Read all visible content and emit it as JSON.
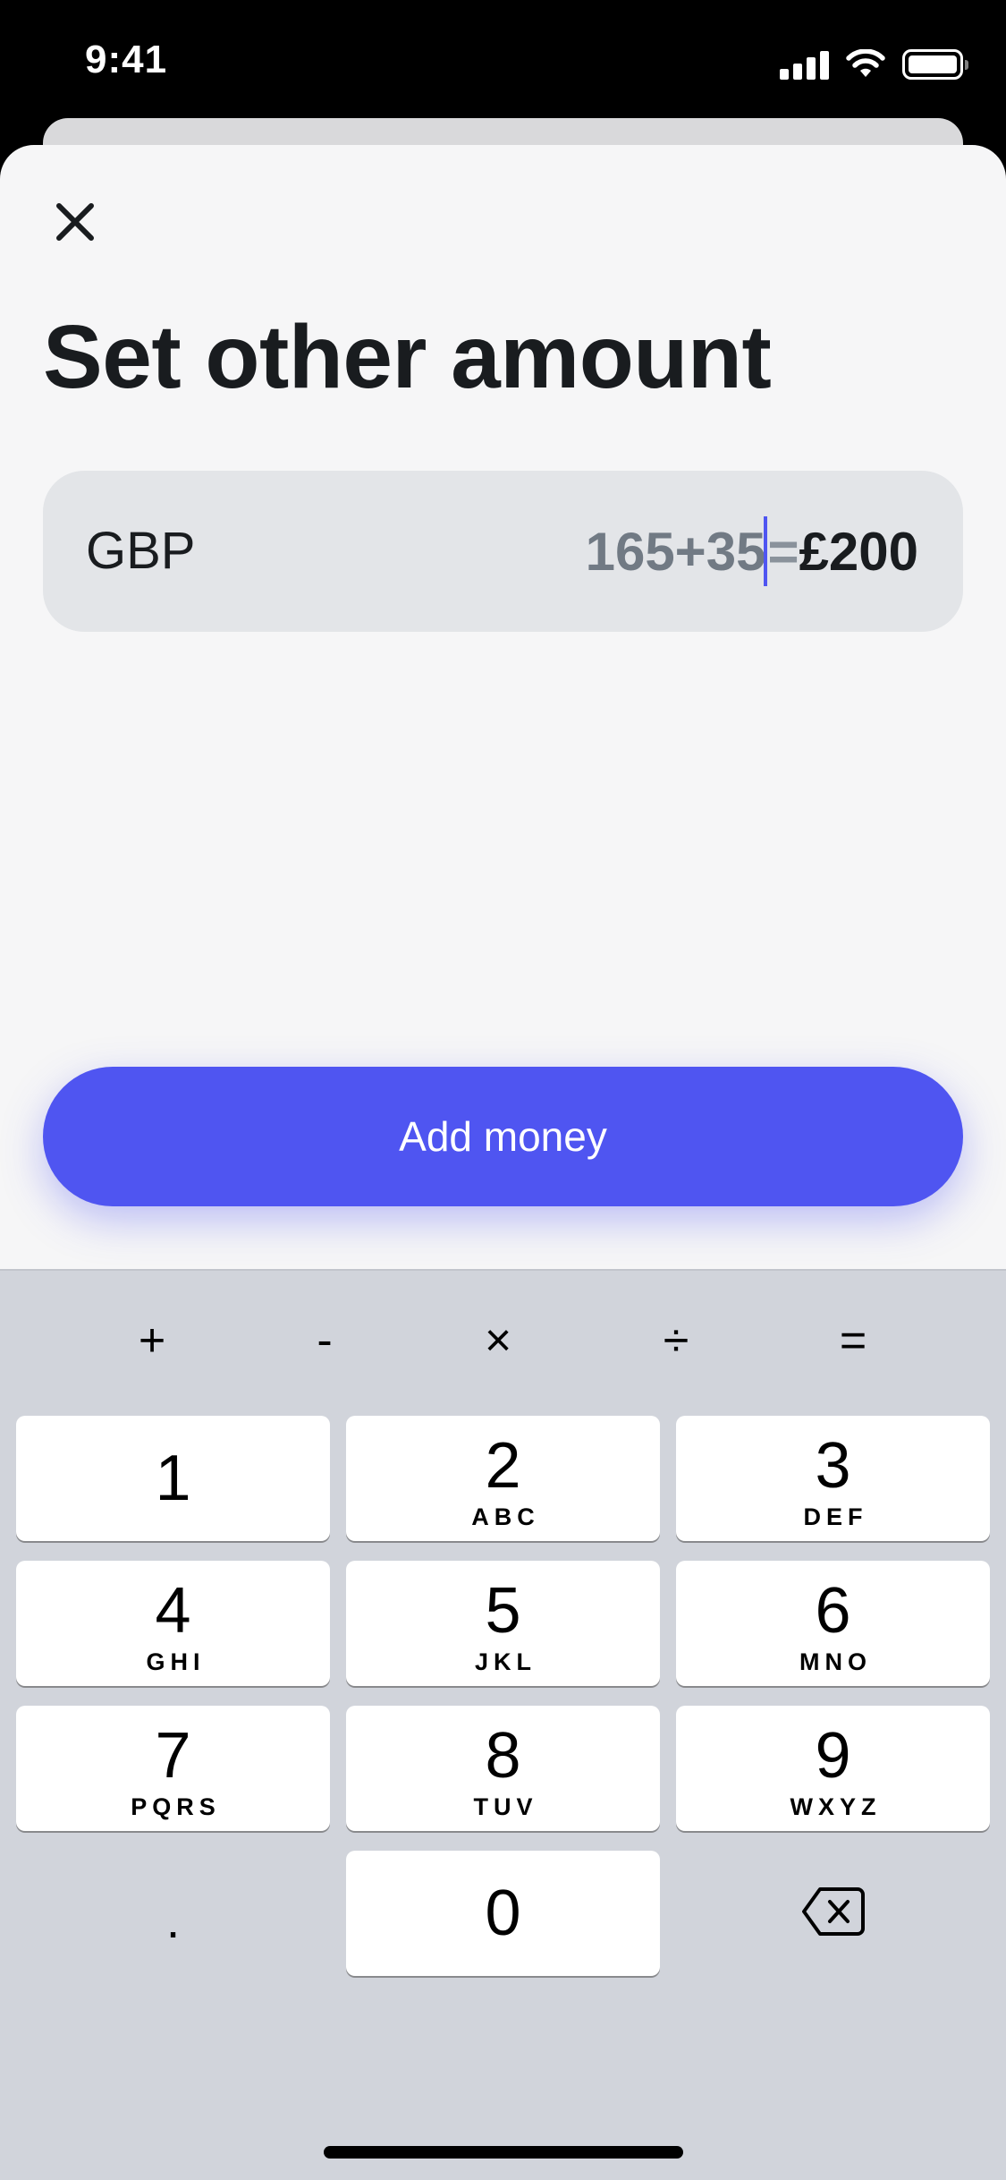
{
  "status_bar": {
    "time": "9:41",
    "icons": [
      "signal-icon",
      "wifi-icon",
      "battery-icon"
    ]
  },
  "header": {
    "close_icon": "close-icon",
    "title": "Set other amount"
  },
  "amount_field": {
    "currency": "GBP",
    "expression": "165+35",
    "equals": "=",
    "result": "£200"
  },
  "primary_button": {
    "label": "Add money",
    "color": "#4F55F1"
  },
  "keyboard": {
    "operators": [
      "+",
      "-",
      "×",
      "÷",
      "="
    ],
    "keys": [
      {
        "num": "1",
        "letters": ""
      },
      {
        "num": "2",
        "letters": "ABC"
      },
      {
        "num": "3",
        "letters": "DEF"
      },
      {
        "num": "4",
        "letters": "GHI"
      },
      {
        "num": "5",
        "letters": "JKL"
      },
      {
        "num": "6",
        "letters": "MNO"
      },
      {
        "num": "7",
        "letters": "PQRS"
      },
      {
        "num": "8",
        "letters": "TUV"
      },
      {
        "num": "9",
        "letters": "WXYZ"
      },
      {
        "num": "0",
        "letters": ""
      }
    ],
    "decimal": ".",
    "delete_icon": "backspace-icon"
  }
}
